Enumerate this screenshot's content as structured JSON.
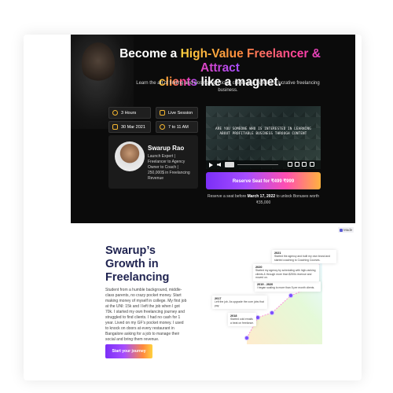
{
  "hero": {
    "title_part1": "Become a ",
    "title_highlight1": "High-Value Freelancer & Attract",
    "title_highlight2": "clients",
    "title_part2": " like a magnet.",
    "subtitle": "Learn the art of finding and closing high ticket clients and building a lucrative freelancing business.",
    "info": {
      "duration": "3 Hours",
      "format": "Live Session",
      "date": "30 Mar 2021",
      "time": "7 to 11 AM"
    },
    "speaker": {
      "name": "Swarup Rao",
      "description": "Launch Expert | Freelancer to Agency Owner to Coach | 250,000$ in Freelancing Revenue"
    },
    "video": {
      "caption": "ARE YOU SOMEONE WHO IS INTERESTED IN LEARNING ABOUT PROFITABLE BUSINESS THROUGH CONTENT"
    },
    "reserve_button": "Reserve Seat for ₹499 ₹999",
    "reserve_note_prefix": "Reserve a seat before ",
    "reserve_note_date": "March 17, 2022",
    "reserve_note_suffix": " to unlock Bonuses worth ₹35,000"
  },
  "badge": {
    "label": "Made"
  },
  "growth": {
    "title": "Swarup’s Growth in Freelancing",
    "body": "Student from a humble background, middle-class parents, no crazy pocket money. Start making money of myself in college. My first job at the UNI: 15k and I left the job when I got 70k. I started my own freelancing journey and struggled to find clients. I had no cash for 1 year. Lived on my GF’s pocket money. I used to knock on doors at every restaurant in Bangalore asking for a job to manage their social and bring them revenue.",
    "button": "Start your journey"
  },
  "timeline": [
    {
      "year": "2017",
      "text": "Left the job. As upgrade the cure jobs that pay."
    },
    {
      "year": "2018",
      "text": "Started cold emails a beat on freelance."
    },
    {
      "year": "2019 - 2020",
      "text": "I began scaling to more than 5 per month clients."
    },
    {
      "year": "2020",
      "text": "Started my agency by scheduling with high-ranking clients & through more than $250k revenue and moved on."
    },
    {
      "year": "2021",
      "text": "Started the agency and built my own brand and started coaching to Coaching Courses."
    }
  ],
  "colors": {
    "accent_purple": "#7b2ff7",
    "accent_pink": "#ff4fb0",
    "accent_orange": "#ffb23f",
    "heading_navy": "#1f2350"
  }
}
